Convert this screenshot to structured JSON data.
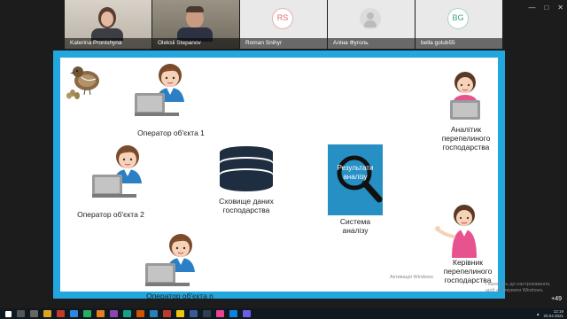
{
  "participants": [
    {
      "name": "Katerina Pronishyna",
      "type": "video"
    },
    {
      "name": "Oleksii Stepanov",
      "type": "video"
    },
    {
      "name": "Roman Snihyr",
      "initials": "RS",
      "type": "initials",
      "color": "#e06b6b"
    },
    {
      "name": "Аліна Фуголь",
      "type": "generic"
    },
    {
      "name": "bella golub55",
      "initials": "BG",
      "type": "initials",
      "color": "#3fa37c"
    }
  ],
  "more_participants": "+49",
  "slide": {
    "border_color": "#21a6dd",
    "operator1": "Оператор об'єкта 1",
    "operator2": "Оператор об'єкта 2",
    "operatorN": "Оператор об'єкта n",
    "storage": [
      "Сховище даних",
      "господарства"
    ],
    "results": [
      "Результати",
      "аналізу"
    ],
    "system": [
      "Система",
      "аналізу"
    ],
    "analyst": [
      "Аналітик",
      "перепелиного",
      "господарства"
    ],
    "head": [
      "Керівник",
      "перепелиного",
      "господарства"
    ]
  },
  "watermark": {
    "line1": "Активація Windows",
    "line2": "Перейдіть до настроювання, щоб активувати Windows."
  },
  "tray": {
    "time": "12:19",
    "date": "20.04.2021"
  }
}
